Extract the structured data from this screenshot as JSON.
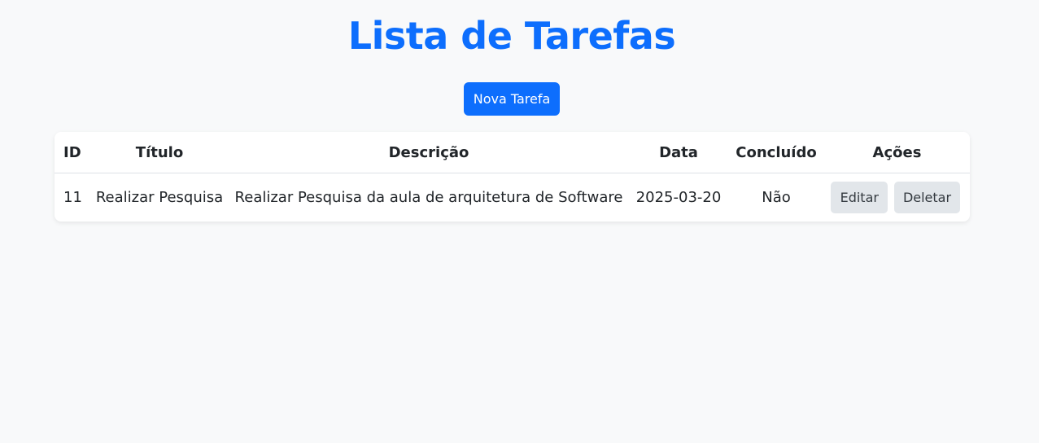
{
  "page": {
    "title": "Lista de Tarefas",
    "new_task_label": "Nova Tarefa"
  },
  "table": {
    "headers": {
      "id": "ID",
      "title": "Título",
      "description": "Descrição",
      "date": "Data",
      "done": "Concluído",
      "actions": "Ações"
    },
    "rows": [
      {
        "id": "11",
        "title": "Realizar Pesquisa",
        "description": "Realizar Pesquisa da aula de arquitetura de Software",
        "date": "2025-03-20",
        "done": "Não",
        "edit_label": "Editar",
        "delete_label": "Deletar"
      }
    ]
  },
  "colors": {
    "primary": "#0d6efd",
    "background": "#f8f9fa",
    "secondary_button": "#e2e6ea"
  }
}
